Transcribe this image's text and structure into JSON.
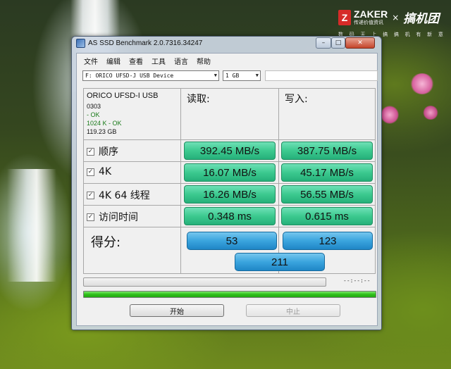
{
  "watermark": {
    "brand_letter": "Z",
    "brand_name": "ZAKER",
    "brand_sub": "传递价值资讯",
    "separator": "×",
    "partner": "搞机团",
    "slogan": [
      "数",
      "码",
      "天",
      "上",
      "搞",
      "搞",
      "机",
      "有",
      "新",
      "意"
    ]
  },
  "window": {
    "title": "AS SSD Benchmark 2.0.7316.34247",
    "controls": {
      "minimize": "–",
      "maximize": "□",
      "close": "✕"
    }
  },
  "menu": [
    "文件",
    "编辑",
    "查看",
    "工具",
    "语言",
    "帮助"
  ],
  "toolbar": {
    "device": "F: ORICO UFSD-J USB Device",
    "size": "1 GB",
    "dropdown_arrow": "▼"
  },
  "drive_info": {
    "name": "ORICO UFSD-I USB",
    "firmware": "0303",
    "driver_status": " - OK",
    "alignment": "1024 K - OK",
    "capacity": "119.23 GB"
  },
  "headers": {
    "read": "读取:",
    "write": "写入:"
  },
  "rows": [
    {
      "label": "顺序",
      "checked": "✓",
      "read": "392.45 MB/s",
      "write": "387.75 MB/s"
    },
    {
      "label": "4K",
      "checked": "✓",
      "read": "16.07 MB/s",
      "write": "45.17 MB/s"
    },
    {
      "label": "4K 64 线程",
      "checked": "✓",
      "read": "16.26 MB/s",
      "write": "56.55 MB/s"
    },
    {
      "label": "访问时间",
      "checked": "✓",
      "read": "0.348 ms",
      "write": "0.615 ms"
    }
  ],
  "score": {
    "label": "得分:",
    "read": "53",
    "write": "123",
    "total": "211"
  },
  "status": {
    "timer": "--:--:--",
    "progress_fraction": 1.0
  },
  "buttons": {
    "start": "开始",
    "stop": "中止"
  },
  "colors": {
    "result_green": "#3cc98f",
    "score_blue": "#3aa4de",
    "progress_green": "#2fc01a"
  }
}
